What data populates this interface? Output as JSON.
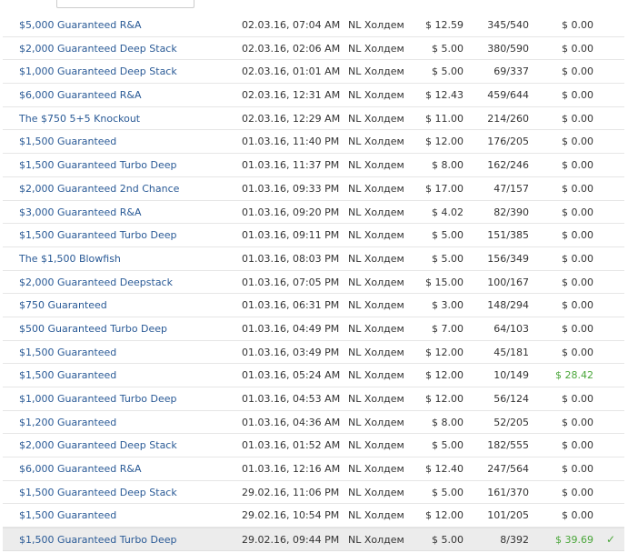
{
  "rows": [
    {
      "name": "$5,000 Guaranteed R&A",
      "date": "02.03.16, 07:04 AM",
      "game": "NL Холдем",
      "buyin": "$ 12.59",
      "players": "345/540",
      "prize": "$ 0.00"
    },
    {
      "name": "$2,000 Guaranteed Deep Stack",
      "date": "02.03.16, 02:06 AM",
      "game": "NL Холдем",
      "buyin": "$ 5.00",
      "players": "380/590",
      "prize": "$ 0.00"
    },
    {
      "name": "$1,000 Guaranteed Deep Stack",
      "date": "02.03.16, 01:01 AM",
      "game": "NL Холдем",
      "buyin": "$ 5.00",
      "players": "69/337",
      "prize": "$ 0.00"
    },
    {
      "name": "$6,000 Guaranteed R&A",
      "date": "02.03.16, 12:31 AM",
      "game": "NL Холдем",
      "buyin": "$ 12.43",
      "players": "459/644",
      "prize": "$ 0.00"
    },
    {
      "name": "The $750 5+5 Knockout",
      "date": "02.03.16, 12:29 AM",
      "game": "NL Холдем",
      "buyin": "$ 11.00",
      "players": "214/260",
      "prize": "$ 0.00"
    },
    {
      "name": "$1,500 Guaranteed",
      "date": "01.03.16, 11:40 PM",
      "game": "NL Холдем",
      "buyin": "$ 12.00",
      "players": "176/205",
      "prize": "$ 0.00"
    },
    {
      "name": "$1,500 Guaranteed Turbo Deep",
      "date": "01.03.16, 11:37 PM",
      "game": "NL Холдем",
      "buyin": "$ 8.00",
      "players": "162/246",
      "prize": "$ 0.00"
    },
    {
      "name": "$2,000 Guaranteed 2nd Chance",
      "date": "01.03.16, 09:33 PM",
      "game": "NL Холдем",
      "buyin": "$ 17.00",
      "players": "47/157",
      "prize": "$ 0.00"
    },
    {
      "name": "$3,000 Guaranteed R&A",
      "date": "01.03.16, 09:20 PM",
      "game": "NL Холдем",
      "buyin": "$ 4.02",
      "players": "82/390",
      "prize": "$ 0.00"
    },
    {
      "name": "$1,500 Guaranteed Turbo Deep",
      "date": "01.03.16, 09:11 PM",
      "game": "NL Холдем",
      "buyin": "$ 5.00",
      "players": "151/385",
      "prize": "$ 0.00"
    },
    {
      "name": "The $1,500 Blowfish",
      "date": "01.03.16, 08:03 PM",
      "game": "NL Холдем",
      "buyin": "$ 5.00",
      "players": "156/349",
      "prize": "$ 0.00"
    },
    {
      "name": "$2,000 Guaranteed Deepstack",
      "date": "01.03.16, 07:05 PM",
      "game": "NL Холдем",
      "buyin": "$ 15.00",
      "players": "100/167",
      "prize": "$ 0.00"
    },
    {
      "name": "$750 Guaranteed",
      "date": "01.03.16, 06:31 PM",
      "game": "NL Холдем",
      "buyin": "$ 3.00",
      "players": "148/294",
      "prize": "$ 0.00"
    },
    {
      "name": "$500 Guaranteed Turbo Deep",
      "date": "01.03.16, 04:49 PM",
      "game": "NL Холдем",
      "buyin": "$ 7.00",
      "players": "64/103",
      "prize": "$ 0.00"
    },
    {
      "name": "$1,500 Guaranteed",
      "date": "01.03.16, 03:49 PM",
      "game": "NL Холдем",
      "buyin": "$ 12.00",
      "players": "45/181",
      "prize": "$ 0.00"
    },
    {
      "name": "$1,500 Guaranteed",
      "date": "01.03.16, 05:24 AM",
      "game": "NL Холдем",
      "buyin": "$ 12.00",
      "players": "10/149",
      "prize": "$ 28.42"
    },
    {
      "name": "$1,000 Guaranteed Turbo Deep",
      "date": "01.03.16, 04:53 AM",
      "game": "NL Холдем",
      "buyin": "$ 12.00",
      "players": "56/124",
      "prize": "$ 0.00"
    },
    {
      "name": "$1,200 Guaranteed",
      "date": "01.03.16, 04:36 AM",
      "game": "NL Холдем",
      "buyin": "$ 8.00",
      "players": "52/205",
      "prize": "$ 0.00"
    },
    {
      "name": "$2,000 Guaranteed Deep Stack",
      "date": "01.03.16, 01:52 AM",
      "game": "NL Холдем",
      "buyin": "$ 5.00",
      "players": "182/555",
      "prize": "$ 0.00"
    },
    {
      "name": "$6,000 Guaranteed R&A",
      "date": "01.03.16, 12:16 AM",
      "game": "NL Холдем",
      "buyin": "$ 12.40",
      "players": "247/564",
      "prize": "$ 0.00"
    },
    {
      "name": "$1,500 Guaranteed Deep Stack",
      "date": "29.02.16, 11:06 PM",
      "game": "NL Холдем",
      "buyin": "$ 5.00",
      "players": "161/370",
      "prize": "$ 0.00"
    },
    {
      "name": "$1,500 Guaranteed",
      "date": "29.02.16, 10:54 PM",
      "game": "NL Холдем",
      "buyin": "$ 12.00",
      "players": "101/205",
      "prize": "$ 0.00"
    },
    {
      "name": "$1,500 Guaranteed Turbo Deep",
      "date": "29.02.16, 09:44 PM",
      "game": "NL Холдем",
      "buyin": "$ 5.00",
      "players": "8/392",
      "prize": "$ 39.69"
    }
  ],
  "icons": {
    "winner_mark": "check-icon"
  },
  "colors": {
    "link": "#2a5a96",
    "win": "#4aa63a",
    "selected_row_bg": "#ececec"
  }
}
